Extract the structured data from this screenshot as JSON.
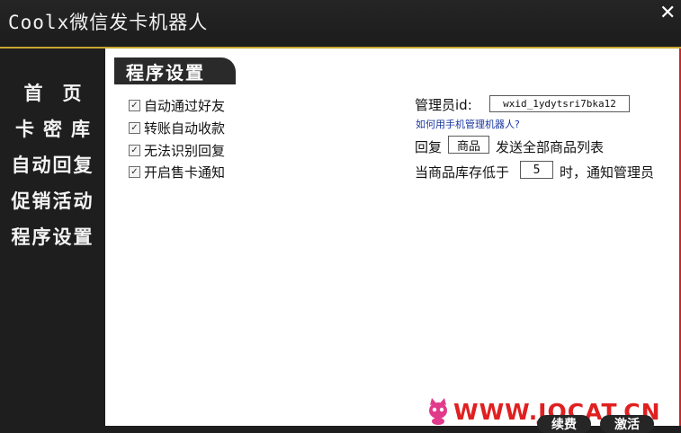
{
  "app": {
    "title": "Coolx微信发卡机器人"
  },
  "sidebar": {
    "items": [
      {
        "label": "首页"
      },
      {
        "label": "卡密库"
      },
      {
        "label": "自动回复"
      },
      {
        "label": "促销活动"
      },
      {
        "label": "程序设置"
      }
    ]
  },
  "settings": {
    "section_title": "程序设置",
    "checkboxes": [
      {
        "label": "自动通过好友",
        "checked": true
      },
      {
        "label": "转账自动收款",
        "checked": true
      },
      {
        "label": "无法识别回复",
        "checked": true
      },
      {
        "label": "开启售卡通知",
        "checked": true
      }
    ],
    "admin_id_label": "管理员id:",
    "admin_id_value": "wxid_1ydytsri7bka12",
    "help_link": "如何用手机管理机器人?",
    "reply_prefix": "回复",
    "reply_keyword": "商品",
    "reply_suffix": "发送全部商品列表",
    "stock_prefix": "当商品库存低于",
    "stock_threshold": "5",
    "stock_suffix": "时，通知管理员"
  },
  "watermark": {
    "text": "WWW.JOCAT.CN"
  },
  "footer": {
    "renew_label": "续费",
    "activate_label": "激活"
  },
  "colors": {
    "accent": "#c9a530",
    "border_red": "#c62828",
    "watermark": "#e02020",
    "link": "#1a35a0"
  }
}
